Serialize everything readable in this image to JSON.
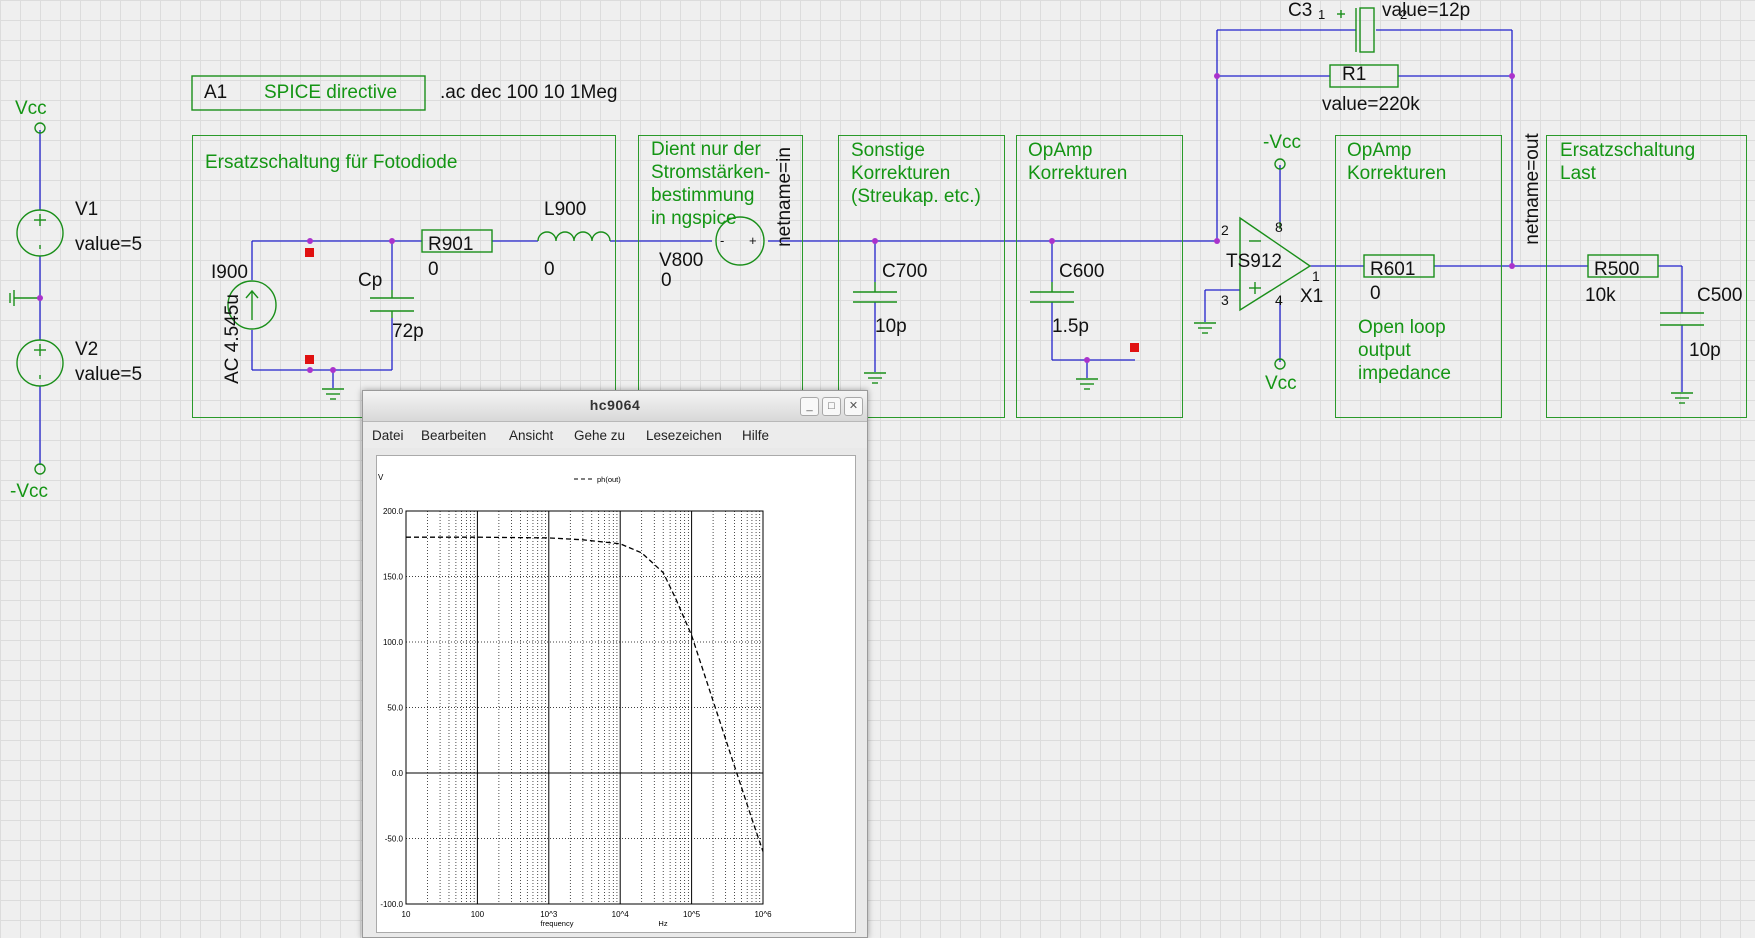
{
  "schematic": {
    "supply_top_label": "Vcc",
    "supply_bottom_label": "-Vcc",
    "v1_name": "V1",
    "v1_value": "value=5",
    "v2_name": "V2",
    "v2_value": "value=5",
    "directive_name": "A1",
    "directive_type": "SPICE directive",
    "directive_text": ".ac dec 100 10 1Meg",
    "photodiode_box_title": "Ersatzschaltung für Fotodiode",
    "i900_name": "I900",
    "i900_value": "AC 4.545u",
    "cp_name": "Cp",
    "cp_value": "72p",
    "r901_name": "R901",
    "r901_value": "0",
    "l900_name": "L900",
    "l900_value": "0",
    "current_box_title": [
      "Dient nur der",
      "Stromstärken-",
      "bestimmung",
      "in ngspice"
    ],
    "v800_name": "V800",
    "v800_value": "0",
    "netname_in": "netname=in",
    "misc_box_title": [
      "Sonstige",
      "Korrekturen",
      "(Streukap. etc.)"
    ],
    "c700_name": "C700",
    "c700_value": "10p",
    "opamp_box1_title": [
      "OpAmp",
      "Korrekturen"
    ],
    "c600_name": "C600",
    "c600_value": "1.5p",
    "c3_name": "C3",
    "c3_value": "value=12p",
    "c3_pin1": "1",
    "c3_pin2": "2",
    "r1_name": "R1",
    "r1_value": "value=220k",
    "opamp_neg_supply": "-Vcc",
    "opamp_pos_supply": "Vcc",
    "opamp_name": "TS912",
    "opamp_instance": "X1",
    "pin2": "2",
    "pin3": "3",
    "pin8": "8",
    "pin4": "4",
    "pin1": "1",
    "opamp_box2_title": [
      "OpAmp",
      "Korrekturen"
    ],
    "r601_name": "R601",
    "r601_value": "0",
    "open_loop_note": [
      "Open loop",
      "output",
      "impedance"
    ],
    "netname_out": "netname=out",
    "load_box_title": [
      "Ersatzschaltung",
      "Last"
    ],
    "r500_name": "R500",
    "r500_value": "10k",
    "c500_name": "C500",
    "c500_value": "10p"
  },
  "plot_window": {
    "title": "hc9064",
    "menu": [
      "Datei",
      "Bearbeiten",
      "Ansicht",
      "Gehe zu",
      "Lesezeichen",
      "Hilfe"
    ],
    "btn_min": "_",
    "btn_max": "□",
    "btn_close": "✕"
  },
  "chart_data": {
    "type": "line",
    "legend": "ph(out)",
    "ylabel": "V",
    "xlabel": "frequency",
    "xunit": "Hz",
    "xscale": "log",
    "xlim": [
      10,
      1000000
    ],
    "ylim": [
      -100,
      200
    ],
    "x_tick_labels": [
      "10",
      "100",
      "10^3",
      "10^4",
      "10^5",
      "10^6"
    ],
    "y_tick_labels": [
      "200.0",
      "150.0",
      "100.0",
      "50.0",
      "0.0",
      "-50.0",
      "-100.0"
    ],
    "y_ticks": [
      200,
      150,
      100,
      50,
      0,
      -50,
      -100
    ],
    "grid": true,
    "line_style": "dashed",
    "series": [
      {
        "name": "ph(out)",
        "x": [
          10,
          100,
          1000,
          3000,
          10000,
          20000,
          40000,
          60000,
          100000,
          200000,
          400000,
          700000,
          1000000
        ],
        "y": [
          180,
          180,
          179.5,
          178,
          175,
          168,
          153,
          133,
          105,
          55,
          5,
          -35,
          -60
        ]
      }
    ]
  }
}
